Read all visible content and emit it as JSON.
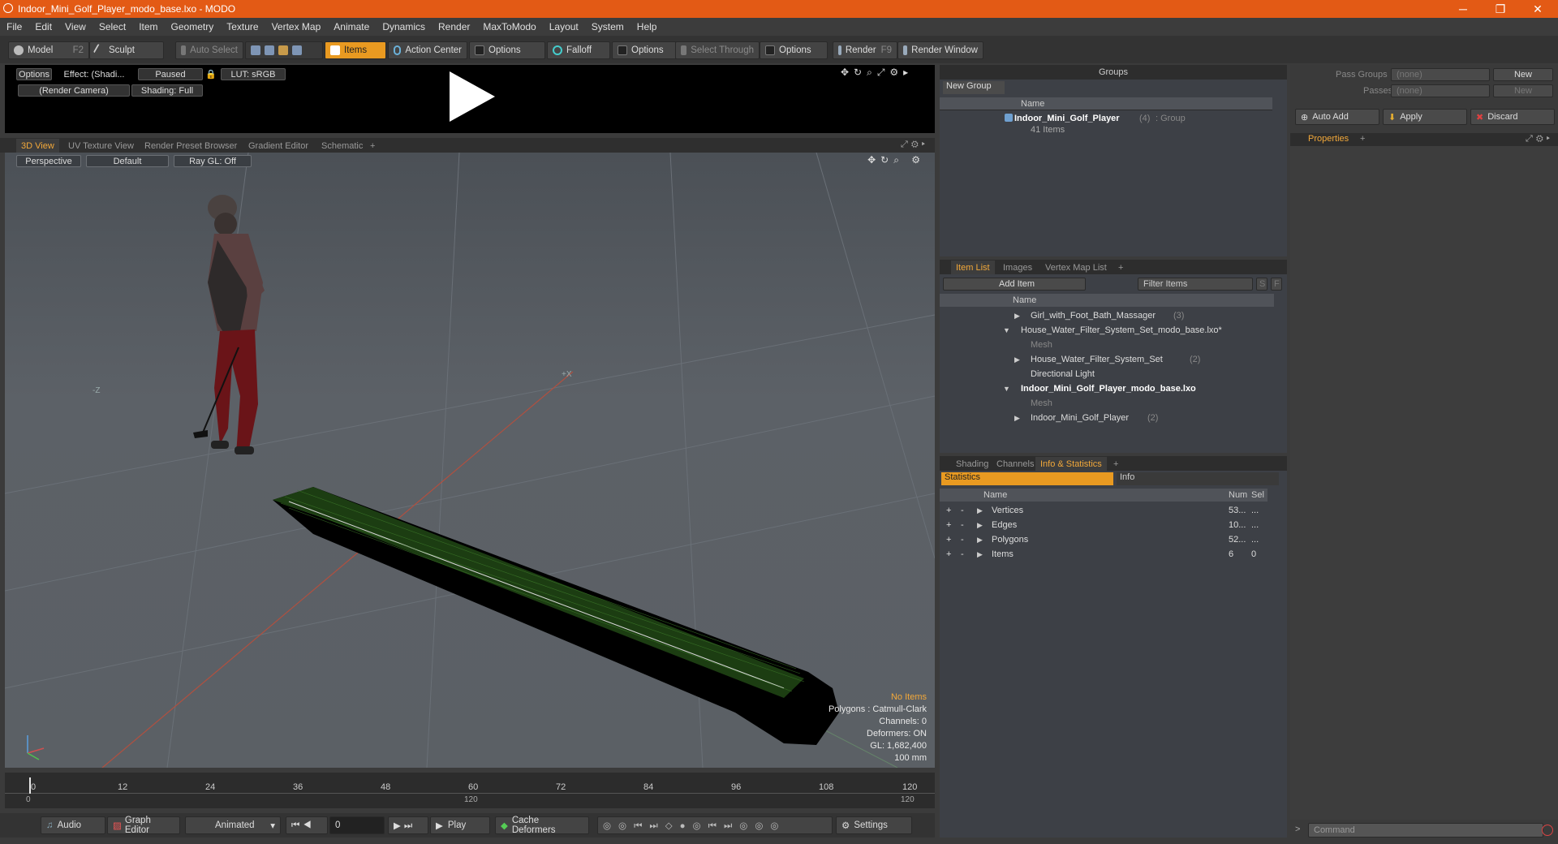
{
  "window": {
    "title": "Indoor_Mini_Golf_Player_modo_base.lxo - MODO",
    "minimize": "─",
    "maximize": "❐",
    "close": "✕"
  },
  "menu": [
    "File",
    "Edit",
    "View",
    "Select",
    "Item",
    "Geometry",
    "Texture",
    "Vertex Map",
    "Animate",
    "Dynamics",
    "Render",
    "MaxToModo",
    "Layout",
    "System",
    "Help"
  ],
  "toolbar": {
    "model": "Model",
    "model_key": "F2",
    "sculpt": "Sculpt",
    "auto_select": "Auto Select",
    "items": "Items",
    "action_center": "Action Center",
    "options1": "Options",
    "falloff": "Falloff",
    "options2": "Options",
    "select_through": "Select Through",
    "options3": "Options",
    "render": "Render",
    "render_key": "F9",
    "render_window": "Render Window"
  },
  "preview": {
    "options": "Options",
    "effect": "Effect: (Shadi...",
    "paused": "Paused",
    "lut": "LUT: sRGB",
    "camera": "(Render Camera)",
    "shading": "Shading: Full"
  },
  "view_tabs": [
    "3D View",
    "UV Texture View",
    "Render Preset Browser",
    "Gradient Editor",
    "Schematic",
    "+"
  ],
  "viewport": {
    "perspective": "Perspective",
    "default": "Default",
    "raygl": "Ray GL: Off",
    "axis_z": "-Z",
    "axis_x": "+X",
    "stats": {
      "no_items": "No Items",
      "polygons": "Polygons : Catmull-Clark",
      "channels": "Channels: 0",
      "deformers": "Deformers: ON",
      "gl": "GL: 1,682,400",
      "scale": "100 mm"
    }
  },
  "timeline": {
    "ticks": [
      "0",
      "12",
      "24",
      "36",
      "48",
      "60",
      "72",
      "84",
      "96",
      "108",
      "120"
    ],
    "start": "0",
    "mid": "120",
    "end": "120"
  },
  "bottombar": {
    "audio": "Audio",
    "graph_editor": "Graph Editor",
    "animated": "Animated",
    "frame": "0",
    "play": "Play",
    "cache_deformers": "Cache Deformers",
    "settings": "Settings"
  },
  "groups": {
    "title": "Groups",
    "new_group": "New Group",
    "col_name": "Name",
    "item_name": "Indoor_Mini_Golf_Player",
    "item_count": "(4)",
    "item_type": ": Group",
    "item_sub": "41 Items"
  },
  "item_list": {
    "tabs": [
      "Item List",
      "Images",
      "Vertex Map List",
      "+"
    ],
    "add_item": "Add Item",
    "filter": "Filter Items",
    "s": "S",
    "f": "F",
    "col_name": "Name",
    "rows": [
      {
        "label": "Girl_with_Foot_Bath_Massager",
        "count": "(3)"
      },
      {
        "label": "House_Water_Filter_System_Set_modo_base.lxo*",
        "count": ""
      },
      {
        "label": "Mesh",
        "count": ""
      },
      {
        "label": "House_Water_Filter_System_Set",
        "count": "(2)"
      },
      {
        "label": "Directional Light",
        "count": ""
      },
      {
        "label": "Indoor_Mini_Golf_Player_modo_base.lxo",
        "count": ""
      },
      {
        "label": "Mesh",
        "count": ""
      },
      {
        "label": "Indoor_Mini_Golf_Player",
        "count": "(2)"
      }
    ]
  },
  "stats_panel": {
    "tabs": [
      "Shading",
      "Channels",
      "Info & Statistics",
      "+"
    ],
    "statistics": "Statistics",
    "info": "Info",
    "col_name": "Name",
    "col_num": "Num",
    "col_sel": "Sel",
    "rows": [
      {
        "name": "Vertices",
        "num": "53...",
        "sel": "..."
      },
      {
        "name": "Edges",
        "num": "10...",
        "sel": "..."
      },
      {
        "name": "Polygons",
        "num": "52...",
        "sel": "..."
      },
      {
        "name": "Items",
        "num": "6",
        "sel": "0"
      }
    ]
  },
  "right": {
    "pass_groups": "Pass Groups",
    "passes": "Passes",
    "none1": "(none)",
    "none2": "(none)",
    "new1": "New",
    "new2": "New",
    "auto_add": "Auto Add",
    "apply": "Apply",
    "discard": "Discard",
    "properties": "Properties",
    "plus": "+",
    "command": "Command"
  }
}
